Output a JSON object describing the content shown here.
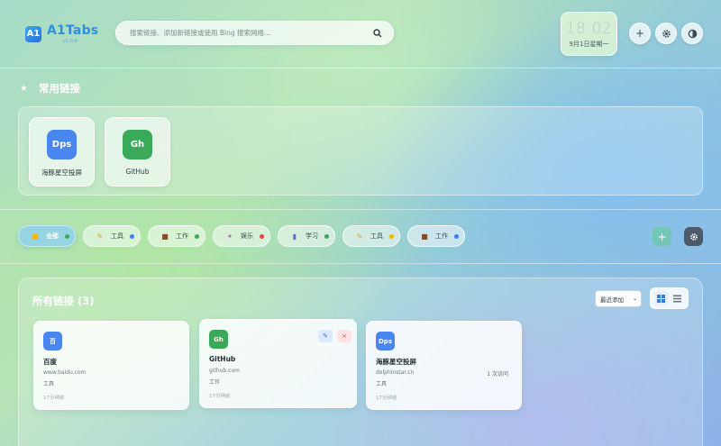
{
  "brand": {
    "logo_mark": "A1",
    "name": "A1Tabs",
    "tagline": "v1.0.0"
  },
  "search": {
    "placeholder": "搜索链接、添加新链接或使用 Bing 搜索网络..."
  },
  "clock": {
    "time": "18:02",
    "date": "9月1日星期一"
  },
  "header_buttons": [
    {
      "name": "add",
      "icon": "plus-icon"
    },
    {
      "name": "settings",
      "icon": "gear-icon"
    },
    {
      "name": "theme",
      "icon": "contrast-icon"
    }
  ],
  "favorites": {
    "title": "常用链接",
    "items": [
      {
        "abbr": "Dps",
        "name": "海豚星空投屏",
        "color": "#4a86f0"
      },
      {
        "abbr": "Gh",
        "name": "GitHub",
        "color": "#3aaa5a"
      }
    ]
  },
  "tags": [
    {
      "label": "全部",
      "icon": "folder-icon",
      "dot": "#3aaa5a",
      "active": true
    },
    {
      "label": "工具",
      "icon": "tools-icon",
      "dot": "#3b82f6"
    },
    {
      "label": "工作",
      "icon": "briefcase-icon",
      "dot": "#3aaa5a"
    },
    {
      "label": "娱乐",
      "icon": "party-icon",
      "dot": "#e5483a"
    },
    {
      "label": "学习",
      "icon": "chart-icon",
      "dot": "#3aaa5a"
    },
    {
      "label": "工具",
      "icon": "tools-icon",
      "dot": "#f5b700"
    },
    {
      "label": "工作",
      "icon": "briefcase-icon",
      "dot": "#3b82f6"
    }
  ],
  "links": {
    "title": "所有链接 (3)",
    "sort": {
      "selected": "最近添加"
    },
    "cards": [
      {
        "abbr": "百",
        "name": "百度",
        "url": "www.baidu.com",
        "tag": "工具",
        "time": "17分钟前",
        "clicks": "",
        "color": "#4a86f0"
      },
      {
        "abbr": "Gh",
        "name": "GitHub",
        "url": "github.com",
        "tag": "工作",
        "time": "17分钟前",
        "clicks": "",
        "color": "#3aaa5a"
      },
      {
        "abbr": "Dps",
        "name": "海豚星空投屏",
        "url": "dolphinstar.cn",
        "tag": "工具",
        "time": "17分钟前",
        "clicks": "1 次访问",
        "color": "#4a86f0"
      }
    ]
  }
}
